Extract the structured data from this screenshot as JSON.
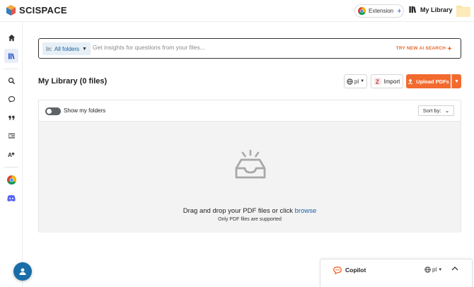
{
  "header": {
    "brand": "SCISPACE",
    "extension_label": "Extension",
    "extension_plus": "+",
    "library_label": "My Library"
  },
  "sidebar": {
    "items": [
      {
        "icon": "home-icon"
      },
      {
        "icon": "library-icon",
        "active": true
      },
      {
        "icon": "search-icon"
      },
      {
        "icon": "chat-icon"
      },
      {
        "icon": "quote-icon"
      },
      {
        "icon": "paraphrase-icon"
      },
      {
        "icon": "ai-detector-icon"
      },
      {
        "icon": "chrome-icon"
      },
      {
        "icon": "discord-icon"
      }
    ]
  },
  "search": {
    "folder_prefix": "In:",
    "folder_value": "All folders",
    "placeholder": "Get insights for questions from your files...",
    "try_new": "TRY NEW AI SEARCH"
  },
  "library": {
    "title": "My Library (0 files)",
    "lang_value": "pl",
    "import_label": "Import",
    "upload_label": "Upload PDFs"
  },
  "panel": {
    "toggle_label": "Show my folders",
    "sort_label": "Sort by:",
    "drop_text": "Drag and drop your PDF files or click",
    "drop_link": "browse",
    "drop_sub": "Only PDF files are supported"
  },
  "copilot": {
    "title": "Copilot",
    "lang_value": "pl"
  },
  "colors": {
    "accent": "#f26a2e",
    "link": "#1a5fa3",
    "fab": "#1a6ea8"
  }
}
